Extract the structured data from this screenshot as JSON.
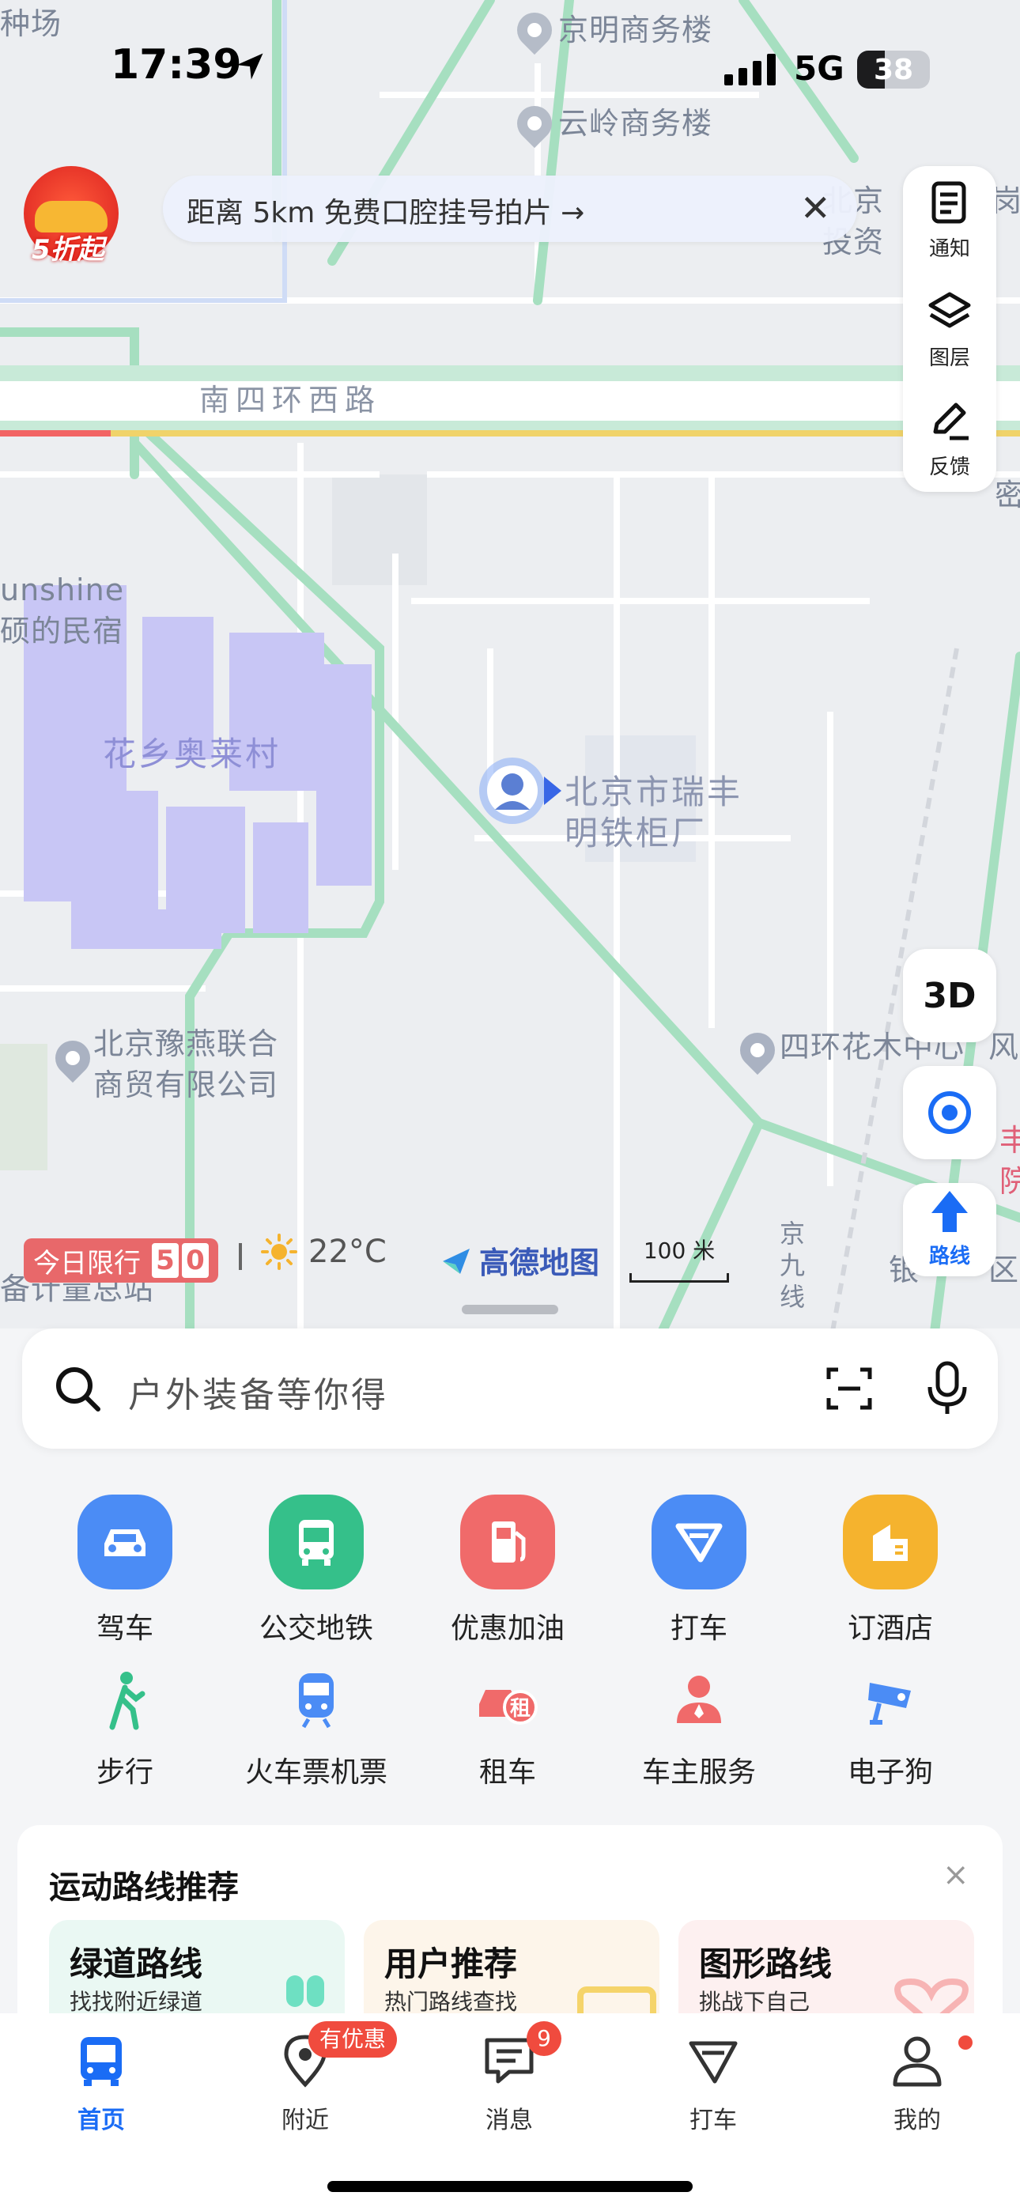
{
  "status_bar": {
    "time": "17:39",
    "network": "5G",
    "battery": "38",
    "battery_level": 0.38
  },
  "map": {
    "labels": {
      "top_left": "种场",
      "jingming": "京明商务楼",
      "yunling": "云岭商务楼",
      "road": "南四环西路",
      "sunshine": "unshine\n硕的民宿",
      "outlet": "花乡奥莱村",
      "poi_current": "北京市瑞丰\n明铁柜厂",
      "yuyan": "北京豫燕联合\n商贸有限公司",
      "huamu": "四环花木中心",
      "feng": "风",
      "feng_yuan": "丰\n院",
      "jing_line": "京\n九\n线",
      "top_right": "北京\n投资",
      "gang": "岗",
      "mi": "密",
      "jiliang": "备计量总站",
      "qu": "区",
      "yin": "银"
    },
    "promo_label": "5折起",
    "notice": "距离 5km 免费口腔挂号拍片 →",
    "tools": {
      "notify": "通知",
      "layers": "图层",
      "feedback": "反馈"
    },
    "btn_3d": "3D",
    "btn_route": "路线",
    "restrict": {
      "label": "今日限行",
      "digits": [
        "5",
        "0"
      ]
    },
    "weather": "22°C",
    "brand": "高德地图",
    "scale": "100 米"
  },
  "search": {
    "placeholder": "户外装备等你得"
  },
  "services_row1": [
    {
      "label": "驾车",
      "color": "#4b8cf5",
      "icon": "car-icon"
    },
    {
      "label": "公交地铁",
      "color": "#35c08a",
      "icon": "bus-icon"
    },
    {
      "label": "优惠加油",
      "color": "#f06a6a",
      "icon": "fuel-icon"
    },
    {
      "label": "打车",
      "color": "#4b8cf5",
      "icon": "taxi-icon"
    },
    {
      "label": "订酒店",
      "color": "#f5b32e",
      "icon": "hotel-icon"
    }
  ],
  "services_row2": [
    {
      "label": "步行",
      "color": "#35c08a",
      "icon": "walk-icon"
    },
    {
      "label": "火车票机票",
      "color": "#4b8cf5",
      "icon": "train-icon"
    },
    {
      "label": "租车",
      "color": "#f06a6a",
      "icon": "rent-car-icon",
      "tag": "租"
    },
    {
      "label": "车主服务",
      "color": "#f06a6a",
      "icon": "driver-service-icon"
    },
    {
      "label": "电子狗",
      "color": "#4b8cf5",
      "icon": "camera-icon"
    }
  ],
  "sport": {
    "title": "运动路线推荐",
    "close": "×",
    "cards": [
      {
        "title": "绿道路线",
        "subtitle": "找找附近绿道",
        "bg": "#eaf8f3"
      },
      {
        "title": "用户推荐",
        "subtitle": "热门路线查找",
        "bg": "#fdf5ea"
      },
      {
        "title": "图形路线",
        "subtitle": "挑战下自己",
        "bg": "#fdf0f0"
      }
    ]
  },
  "tabbar": {
    "tabs": [
      {
        "label": "首页",
        "icon": "home-bus-icon",
        "active": true
      },
      {
        "label": "附近",
        "icon": "nearby-pin-icon"
      },
      {
        "label": "消息",
        "icon": "message-icon"
      },
      {
        "label": "打车",
        "icon": "taxi-tab-icon"
      },
      {
        "label": "我的",
        "icon": "profile-icon"
      }
    ],
    "nearby_badge": "有优惠",
    "message_count": "9"
  }
}
